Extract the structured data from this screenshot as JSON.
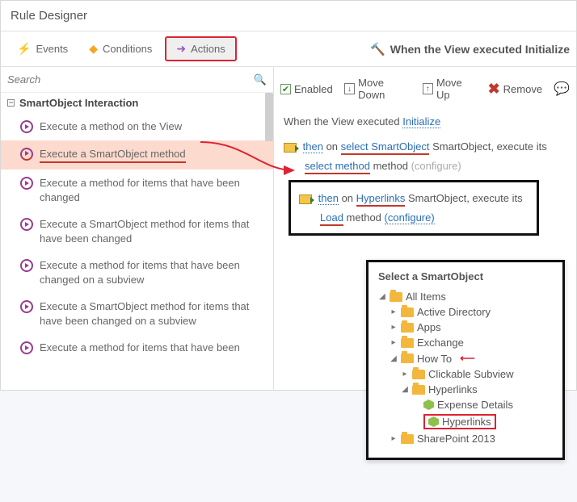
{
  "title": "Rule Designer",
  "tabs": {
    "events": "Events",
    "conditions": "Conditions",
    "actions": "Actions"
  },
  "header_caption": "When the View executed Initialize",
  "search_placeholder": "Search",
  "group_title": "SmartObject Interaction",
  "actions_list": [
    "Execute a method on the View",
    "Execute a SmartObject method",
    "Execute a method for items that have been changed",
    "Execute a SmartObject method for items that have been changed",
    "Execute a method for items that have been changed on a subview",
    "Execute a SmartObject method for items that have been changed on a subview",
    "Execute a method for items that have been"
  ],
  "right_toolbar": {
    "enabled": "Enabled",
    "move_down": "Move Down",
    "move_up": "Move Up",
    "remove": "Remove"
  },
  "sentence": {
    "prefix": "When the View executed",
    "initialize": "Initialize",
    "then": "then",
    "on": "on",
    "select_so": "select SmartObject",
    "so_tail": "SmartObject, execute its",
    "select_method": "select method",
    "method_word": "method",
    "configure": "(configure)",
    "hyperlinks": "Hyperlinks",
    "load": "Load",
    "configure_link": "(configure)"
  },
  "popup": {
    "title": "Select a SmartObject",
    "nodes": {
      "all": "All Items",
      "ad": "Active Directory",
      "apps": "Apps",
      "exchange": "Exchange",
      "howto": "How To",
      "clickable": "Clickable Subview",
      "hyper_folder": "Hyperlinks",
      "expense": "Expense Details",
      "hyper_obj": "Hyperlinks",
      "sp": "SharePoint 2013"
    }
  }
}
